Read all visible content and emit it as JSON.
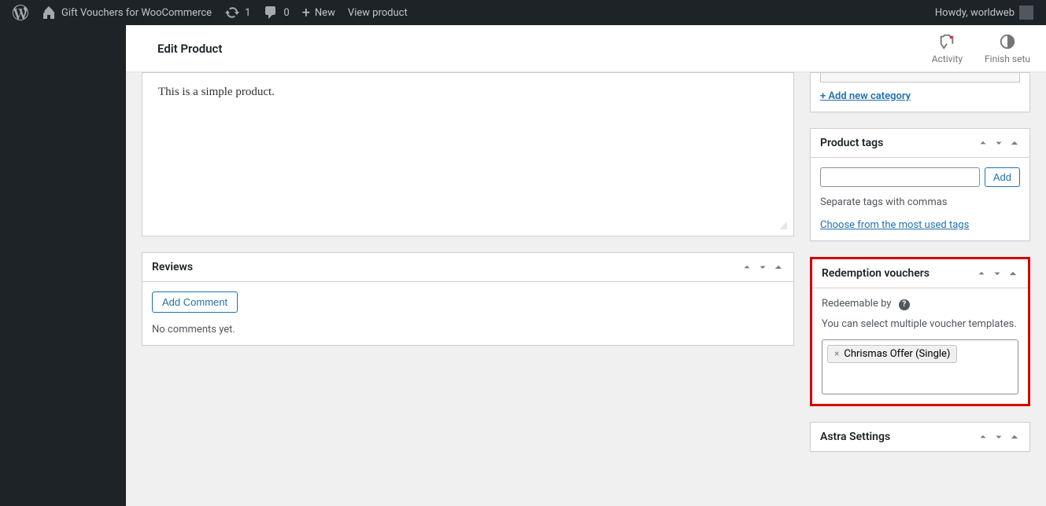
{
  "adminbar": {
    "site_title": "Gift Vouchers for WooCommerce",
    "updates": "1",
    "comments": "0",
    "new": "New",
    "view_product": "View product",
    "howdy": "Howdy, worldweb"
  },
  "page": {
    "title": "Edit Product"
  },
  "top_actions": {
    "activity": "Activity",
    "finish_setup": "Finish setu"
  },
  "editor": {
    "content": "This is a simple product."
  },
  "reviews": {
    "title": "Reviews",
    "add_comment": "Add Comment",
    "empty": "No comments yet."
  },
  "categories": {
    "add_new": "+ Add new category"
  },
  "tags": {
    "title": "Product tags",
    "add": "Add",
    "hint": "Separate tags with commas",
    "choose": "Choose from the most used tags"
  },
  "vouchers": {
    "title": "Redemption vouchers",
    "label": "Redeemable by",
    "desc": "You can select multiple voucher templates.",
    "chip": "Chrismas Offer (Single)"
  },
  "astra": {
    "title": "Astra Settings"
  }
}
